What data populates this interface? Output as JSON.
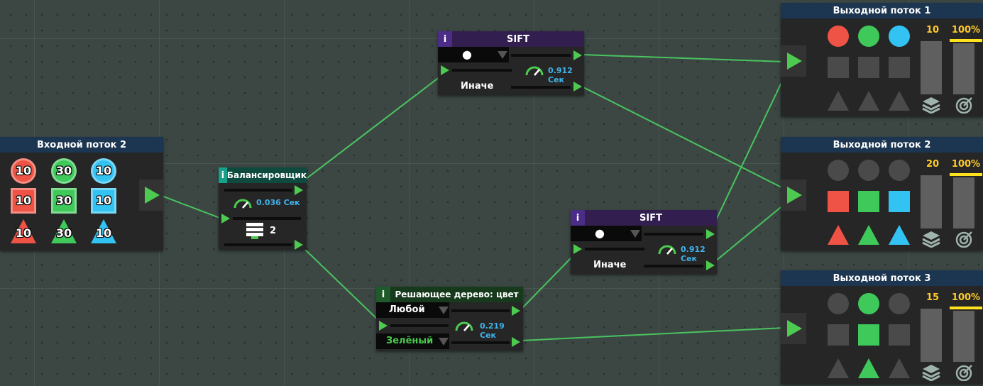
{
  "input_node": {
    "title": "Входной поток 2",
    "rows": [
      {
        "shape": "circle",
        "items": [
          {
            "color": "#ef5345",
            "count": "10"
          },
          {
            "color": "#3fc95a",
            "count": "30"
          },
          {
            "color": "#33c3f2",
            "count": "10"
          }
        ]
      },
      {
        "shape": "square",
        "items": [
          {
            "color": "#ef5345",
            "count": "10"
          },
          {
            "color": "#3fc95a",
            "count": "30"
          },
          {
            "color": "#33c3f2",
            "count": "10"
          }
        ]
      },
      {
        "shape": "triangle",
        "items": [
          {
            "color": "#ef5345",
            "count": "10"
          },
          {
            "color": "#3fc95a",
            "count": "30"
          },
          {
            "color": "#33c3f2",
            "count": "10"
          }
        ]
      }
    ]
  },
  "balancer_node": {
    "info": "i",
    "title": "Балансировщик",
    "speed": "0.036 Сек",
    "count": "2"
  },
  "sift_top": {
    "info": "i",
    "title": "SIFT",
    "selector": "●",
    "speed": "0.912 Сек",
    "else_label": "Иначе"
  },
  "sift_bottom": {
    "info": "i",
    "title": "SIFT",
    "selector": "●",
    "speed": "0.912 Сек",
    "else_label": "Иначе"
  },
  "decision_node": {
    "info": "i",
    "title": "Решающее дерево: цвет",
    "option_any": "Любой",
    "speed": "0.219 Сек",
    "option_green": "Зелёный"
  },
  "outputs": [
    {
      "title": "Выходной поток 1",
      "count": "10",
      "percent": "100%",
      "circles": [
        "#ef5345",
        "#3fc95a",
        "#33c3f2"
      ],
      "squares": [
        "#4a4a4a",
        "#4a4a4a",
        "#4a4a4a"
      ],
      "triangles": [
        "#4a4a4a",
        "#4a4a4a",
        "#4a4a4a"
      ],
      "count_fill": 0.0,
      "percent_fill": 1.0
    },
    {
      "title": "Выходной поток 2",
      "count": "20",
      "percent": "100%",
      "circles": [
        "#4a4a4a",
        "#4a4a4a",
        "#4a4a4a"
      ],
      "squares": [
        "#ef5345",
        "#3fc95a",
        "#33c3f2"
      ],
      "triangles": [
        "#ef5345",
        "#3fc95a",
        "#33c3f2"
      ],
      "count_fill": 0.0,
      "percent_fill": 1.0
    },
    {
      "title": "Выходной поток 3",
      "count": "15",
      "percent": "100%",
      "circles": [
        "#4a4a4a",
        "#3fc95a",
        "#4a4a4a"
      ],
      "squares": [
        "#4a4a4a",
        "#3fc95a",
        "#4a4a4a"
      ],
      "triangles": [
        "#4a4a4a",
        "#3fc95a",
        "#4a4a4a"
      ],
      "count_fill": 0.0,
      "percent_fill": 1.0
    }
  ],
  "colors": {
    "wire": "#4cd964",
    "play": "#4ccb50",
    "speed": "#3fb3ec",
    "percent": "#ffcb2a",
    "target_line": "#ffe11e"
  },
  "icons": [
    "play-arrow-icon",
    "speedometer-icon",
    "stack-layers-icon",
    "target-icon",
    "dropdown-arrow-icon",
    "server-stack-icon"
  ]
}
